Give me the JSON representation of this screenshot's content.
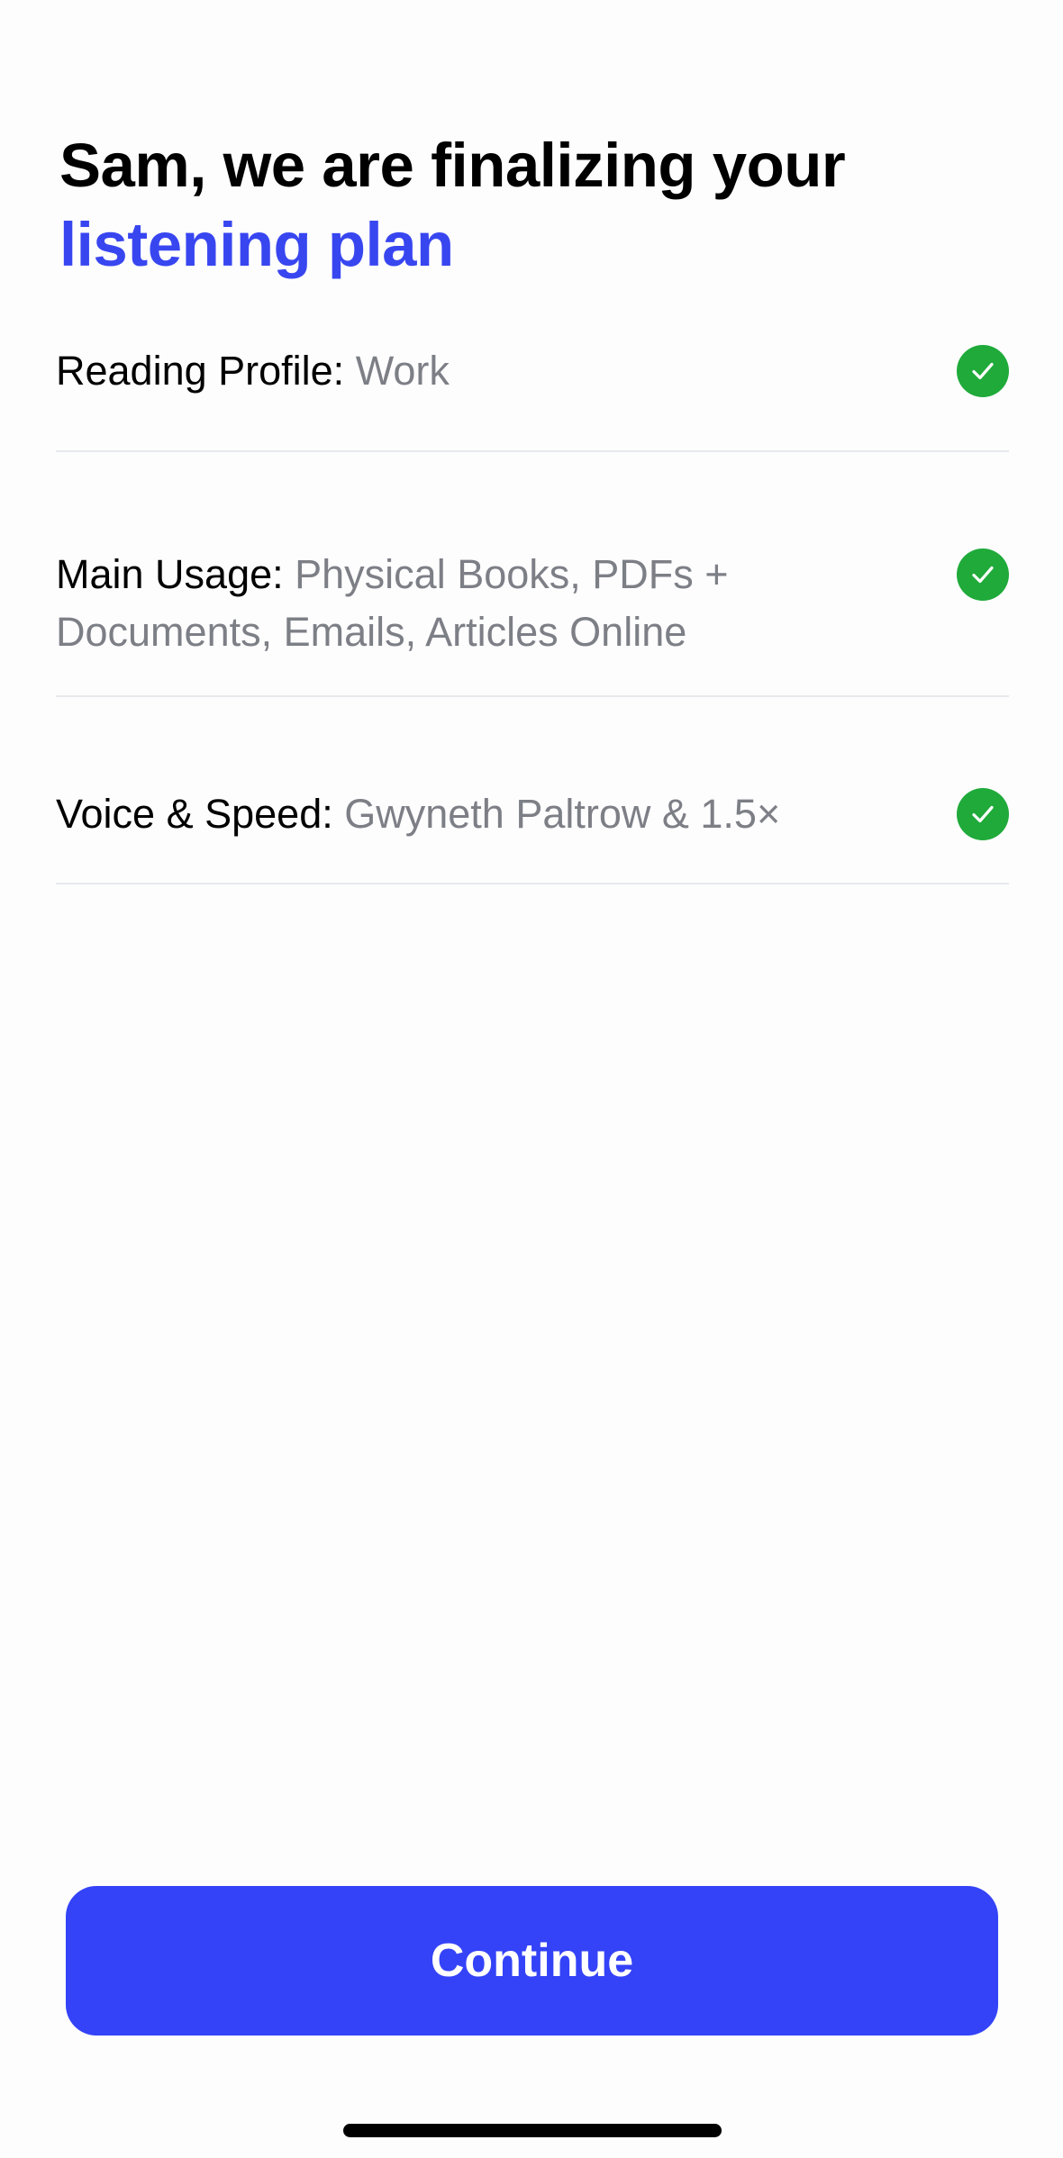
{
  "header": {
    "title_line1": "Sam, we are finalizing your",
    "title_line2": "listening plan"
  },
  "summary": [
    {
      "label": "Reading Profile:",
      "value": "Work",
      "status_icon": "checkmark-circle-icon"
    },
    {
      "label": "Main Usage:",
      "value": "Physical Books, PDFs + Documents, Emails, Articles Online",
      "status_icon": "checkmark-circle-icon"
    },
    {
      "label": "Voice & Speed:",
      "value": "Gwyneth Paltrow & 1.5×",
      "status_icon": "checkmark-circle-icon"
    }
  ],
  "actions": {
    "continue_label": "Continue"
  },
  "colors": {
    "accent": "#3846f0",
    "button": "#3443f7",
    "success": "#1faa3a",
    "value_text": "#7d7f86",
    "divider": "#e7e9ec"
  }
}
